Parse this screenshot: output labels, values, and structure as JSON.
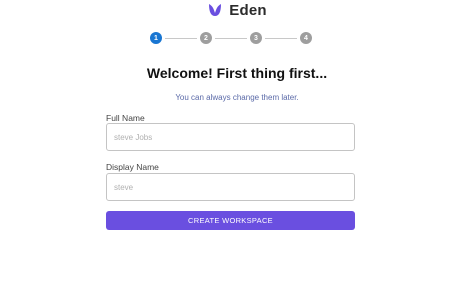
{
  "brand": {
    "name": "Eden",
    "logo_icon": "leaf-logo-icon",
    "color": "#6a4fe0"
  },
  "stepper": {
    "steps": [
      "1",
      "2",
      "3",
      "4"
    ],
    "active_index": 0,
    "active_color": "#1976d2",
    "inactive_color": "#9e9e9e"
  },
  "form": {
    "title": "Welcome! First thing first...",
    "subtitle": "You can always change them later.",
    "full_name": {
      "label": "Full Name",
      "placeholder": "steve Jobs",
      "value": ""
    },
    "display_name": {
      "label": "Display Name",
      "placeholder": "steve",
      "value": ""
    },
    "submit_label": "CREATE WORKSPACE",
    "submit_color": "#6a4fe0"
  }
}
